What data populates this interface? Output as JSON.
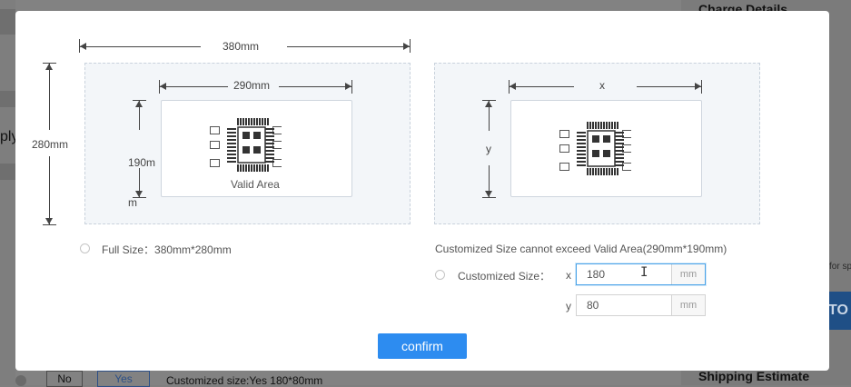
{
  "background": {
    "charge_details": "Charge Details",
    "left_fragment": "ply",
    "link_fragment": "for sp",
    "blue_button_fragment": "TO",
    "shipping_estimate": "Shipping Estimate",
    "option_no": "No",
    "option_yes": "Yes",
    "customized_summary": "Customized size:Yes 180*80mm"
  },
  "full_size_diagram": {
    "outer_width_label": "380mm",
    "outer_height_label": "280mm",
    "inner_width_label": "290mm",
    "inner_height_label": "190mm",
    "valid_area_label": "Valid Area"
  },
  "custom_size_diagram": {
    "width_label": "x",
    "height_label": "y"
  },
  "options": {
    "full_size_label": "Full Size：380mm*280mm",
    "custom_note": "Customized Size cannot exceed Valid Area(290mm*190mm)",
    "custom_label": "Customized Size：",
    "x_label": "x",
    "y_label": "y",
    "x_value": "180",
    "y_value": "80",
    "unit": "mm"
  },
  "confirm_label": "confirm",
  "colors": {
    "accent": "#2d8cf0",
    "panel_bg": "#f3f6f9",
    "overlay": "#828282"
  },
  "icons": {
    "chip": "pcb-chip-icon",
    "text_cursor": "text-cursor-icon"
  }
}
